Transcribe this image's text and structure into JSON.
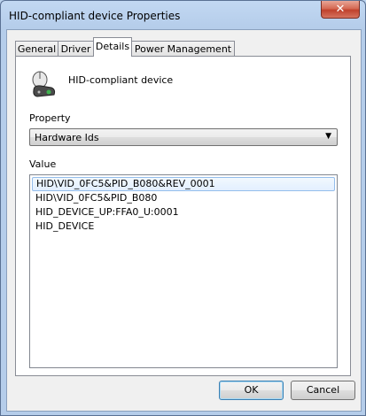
{
  "window": {
    "title": "HID-compliant device Properties",
    "close_glyph": "✕"
  },
  "tabs": [
    {
      "label": "General"
    },
    {
      "label": "Driver"
    },
    {
      "label": "Details"
    },
    {
      "label": "Power Management"
    }
  ],
  "active_tab": "Details",
  "device": {
    "name": "HID-compliant device",
    "icon": "mouse-keyboard-device-icon"
  },
  "property": {
    "label": "Property",
    "selected": "Hardware Ids"
  },
  "value": {
    "label": "Value",
    "items": [
      "HID\\VID_0FC5&PID_B080&REV_0001",
      "HID\\VID_0FC5&PID_B080",
      "HID_DEVICE_UP:FFA0_U:0001",
      "HID_DEVICE"
    ]
  },
  "buttons": {
    "ok": "OK",
    "cancel": "Cancel"
  },
  "colors": {
    "selection_border": "#94bdeb",
    "close_button": "#c0412c"
  }
}
